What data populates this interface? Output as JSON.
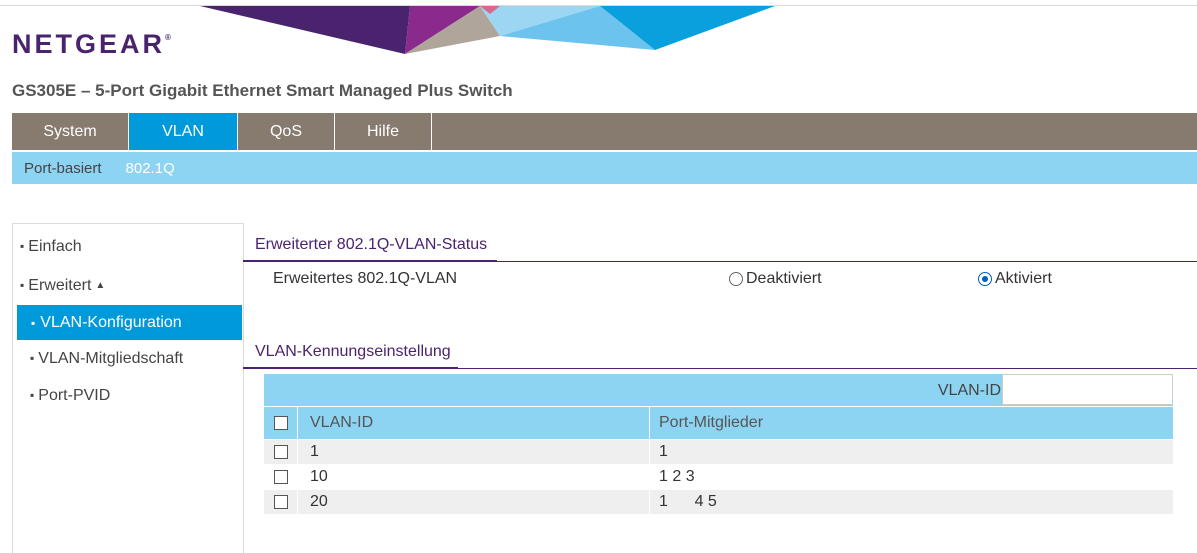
{
  "brand": {
    "name": "NETGEAR",
    "trademark": "®"
  },
  "product_title": "GS305E – 5-Port Gigabit Ethernet Smart Managed Plus Switch",
  "main_nav": [
    {
      "label": "System",
      "active": false
    },
    {
      "label": "VLAN",
      "active": true
    },
    {
      "label": "QoS",
      "active": false
    },
    {
      "label": "Hilfe",
      "active": false
    }
  ],
  "sub_nav": [
    {
      "label": "Port-basiert",
      "active": false
    },
    {
      "label": "802.1Q",
      "active": true
    }
  ],
  "sidebar": {
    "items": [
      {
        "label": "Einfach"
      },
      {
        "label": "Erweitert",
        "expanded": true
      },
      {
        "label": "VLAN-Konfiguration",
        "active": true
      },
      {
        "label": "VLAN-Mitgliedschaft"
      },
      {
        "label": "Port-PVID"
      }
    ]
  },
  "status_section": {
    "title": "Erweiterter 802.1Q-VLAN-Status",
    "label": "Erweitertes 802.1Q-VLAN",
    "options": [
      {
        "label": "Deaktiviert",
        "selected": false
      },
      {
        "label": "Aktiviert",
        "selected": true
      }
    ]
  },
  "id_section": {
    "title": "VLAN-Kennungseinstellung",
    "search_label": "VLAN-ID",
    "search_value": "",
    "columns": [
      "VLAN-ID",
      "Port-Mitglieder"
    ],
    "rows": [
      {
        "vlan_id": "1",
        "ports": "1"
      },
      {
        "vlan_id": "10",
        "ports": "1 2 3"
      },
      {
        "vlan_id": "20",
        "ports": "1      4 5"
      }
    ]
  },
  "colors": {
    "brand_purple": "#4a236e",
    "nav_grey": "#877b70",
    "accent_blue": "#0099d9",
    "light_blue": "#8dd4f3"
  }
}
